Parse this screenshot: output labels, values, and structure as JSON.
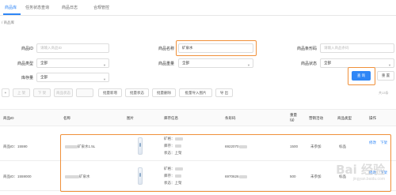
{
  "nav": {
    "tabs": [
      "商品库",
      "任务状态查询",
      "商品日志",
      "合规管控"
    ]
  },
  "breadcrumb": "/ 商品库",
  "filters": {
    "product_id": {
      "label": "商品ID",
      "placeholder": "请输入商品ID"
    },
    "product_name": {
      "label": "商品名称",
      "value": "矿泉水"
    },
    "barcode": {
      "label": "商品条形码",
      "placeholder": "请输入商品条码"
    },
    "product_type": {
      "label": "商品类型",
      "value": "全部"
    },
    "weight": {
      "label": "商品重量",
      "value": "全部"
    },
    "status": {
      "label": "商品状态",
      "value": "全部"
    },
    "stock": {
      "label": "库存量",
      "value": "全部"
    }
  },
  "buttons": {
    "query": "查 询",
    "reset": "重 置",
    "add": "新增",
    "on_shelf": "上 架",
    "off_shelf": "下 架",
    "batch_status": "商品状态",
    "batch_add": "批量新增",
    "batch_state": "批量状态",
    "batch_delete": "批量删除",
    "batch_import_images": "批量导入图片",
    "export": "导 出"
  },
  "total_text": "共13条",
  "table": {
    "headers": [
      "商品ID",
      "名称",
      "图片",
      "库存信息",
      "条形码",
      "重量(g)",
      "营销活动",
      "商品类型",
      "操作"
    ],
    "rows": [
      {
        "id": "商品ID：15590",
        "name": "矿泉水1.5L",
        "stock_code": "矿格：",
        "stock_qty": "库存：",
        "stock_status": "状态：上架",
        "barcode": "6922070",
        "weight": "1500",
        "promo": "未参加",
        "type": "标品",
        "op_edit": "修改",
        "op_off": "下架"
      },
      {
        "id": "商品ID：1559000",
        "name": "矿泉水",
        "stock_code": "矿格：",
        "stock_qty": "库存：",
        "stock_status": "状态：上架",
        "barcode": "6970626",
        "weight": "500",
        "promo": "未参加",
        "type": "标品",
        "op_edit": "修改",
        "op_off": "下架"
      }
    ]
  },
  "watermark": {
    "main": "Bai 经验",
    "sub": "jingyan.baidu.com"
  },
  "colors": {
    "primary": "#2f86f6",
    "highlight": "#f0903a"
  }
}
